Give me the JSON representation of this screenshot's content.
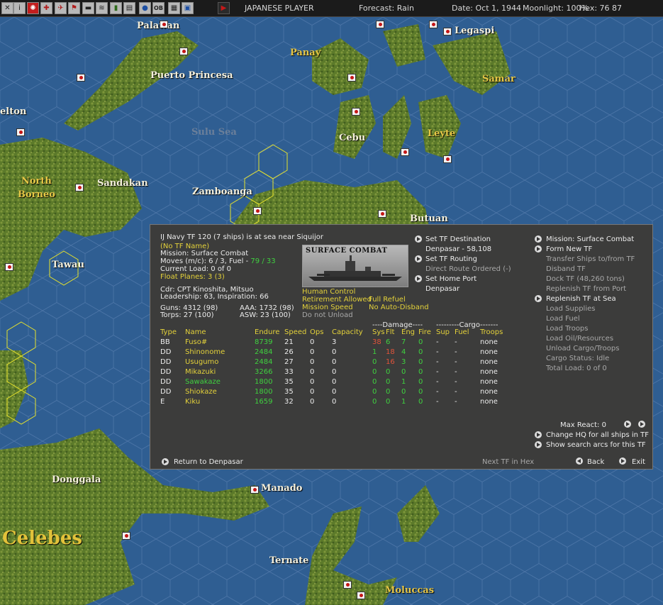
{
  "toolbar": {
    "player": "JAPANESE PLAYER",
    "forecast": "Forecast: Rain",
    "date": "Date: Oct 1, 1944",
    "moonlight": "Moonlight: 100%",
    "hex": "Hex: 76 87",
    "buttons": [
      "close-icon",
      "info-icon",
      "rising-sun-icon",
      "army-icon",
      "navy-icon",
      "flag-icon",
      "transport-icon",
      "intel-icon",
      "fuel-icon",
      "ledger-icon",
      "globe-icon",
      "ob-icon",
      "report-icon",
      "window-icon",
      "play-icon"
    ]
  },
  "map": {
    "places": [
      "Palawan",
      "Legaspi",
      "Panay",
      "Samar",
      "Puerto Princesa",
      "elton",
      "Sulu Sea",
      "Cebu",
      "Leyte",
      "North",
      "Borneo",
      "Sandakan",
      "Zamboanga",
      "Butuan",
      "Tawau",
      "Donggala",
      "Manado",
      "Celebes",
      "Ternate",
      "Moluccas"
    ]
  },
  "panel": {
    "header": "IJ Navy TF 120 (7 ships) is at sea near Siquijor",
    "tf_name": "(No TF Name)",
    "mission": "Mission: Surface Combat",
    "moves_prefix": "Moves (m/c): 6 / 3, Fuel - ",
    "fuel_value": "79 / 33",
    "current_load": "Current Load: 0 of 0",
    "float_planes": "Float Planes: 3 (3)",
    "cdr": "Cdr: CPT  Kinoshita, Mitsuo",
    "leadership": "Leadership: 63, Inspiration: 66",
    "guns": "Guns: 4312 (98)",
    "aaa": "AAA: 1732 (98)",
    "torps": "Torps: 27 (100)",
    "asw": "ASW: 23 (100)",
    "image_title": "SURFACE COMBAT",
    "options": {
      "human_control": "Human Control",
      "retirement": "Retirement Allowed",
      "full_refuel": "Full Refuel",
      "mission_speed": "Mission Speed",
      "no_auto_disband": "No Auto-Disband",
      "do_not_unload": "Do not Unload"
    },
    "routing": {
      "set_destination": "Set TF Destination",
      "destination": "Denpasar - 58,108",
      "set_routing": "Set TF Routing",
      "direct_route": "Direct Route Ordered (-)",
      "set_home_port": "Set Home Port",
      "home_port": "Denpasar"
    },
    "commands": {
      "mission": "Mission: Surface Combat",
      "form_new": "Form New TF",
      "transfer": "Transfer Ships to/from TF",
      "disband": "Disband TF",
      "dock": "Dock TF (48,260 tons)",
      "replenish_port": "Replenish TF from Port",
      "replenish_sea": "Replenish TF at Sea",
      "load_supplies": "Load Supplies",
      "load_fuel": "Load Fuel",
      "load_troops": "Load Troops",
      "load_oil": "Load Oil/Resources",
      "unload": "Unload Cargo/Troops",
      "cargo_status": "Cargo Status: Idle",
      "total_load": "Total Load: 0 of 0"
    },
    "table": {
      "damage_group": "----Damage----",
      "cargo_group": "---------Cargo-------",
      "headers": [
        "Type",
        "Name",
        "Endure",
        "Speed",
        "Ops",
        "Capacity",
        "Sys",
        "Flt",
        "Eng",
        "Fire",
        "Sup",
        "Fuel",
        "Troops"
      ],
      "rows": [
        {
          "type": "BB",
          "name": "Fuso#",
          "endure": "8739",
          "speed": "21",
          "ops": "0",
          "capacity": "3",
          "sys": "38",
          "flt": "6",
          "eng": "7",
          "fire": "0",
          "sup": "-",
          "fuel": "-",
          "troops": "none"
        },
        {
          "type": "DD",
          "name": "Shinonome",
          "endure": "2484",
          "speed": "26",
          "ops": "0",
          "capacity": "0",
          "sys": "1",
          "flt": "18",
          "eng": "4",
          "fire": "0",
          "sup": "-",
          "fuel": "-",
          "troops": "none"
        },
        {
          "type": "DD",
          "name": "Usugumo",
          "endure": "2484",
          "speed": "27",
          "ops": "0",
          "capacity": "0",
          "sys": "0",
          "flt": "16",
          "eng": "3",
          "fire": "0",
          "sup": "-",
          "fuel": "-",
          "troops": "none"
        },
        {
          "type": "DD",
          "name": "Mikazuki",
          "endure": "3266",
          "speed": "33",
          "ops": "0",
          "capacity": "0",
          "sys": "0",
          "flt": "0",
          "eng": "0",
          "fire": "0",
          "sup": "-",
          "fuel": "-",
          "troops": "none"
        },
        {
          "type": "DD",
          "name": "Sawakaze",
          "endure": "1800",
          "speed": "35",
          "ops": "0",
          "capacity": "0",
          "sys": "0",
          "flt": "0",
          "eng": "1",
          "fire": "0",
          "sup": "-",
          "fuel": "-",
          "troops": "none"
        },
        {
          "type": "DD",
          "name": "Shiokaze",
          "endure": "1800",
          "speed": "35",
          "ops": "0",
          "capacity": "0",
          "sys": "0",
          "flt": "0",
          "eng": "0",
          "fire": "0",
          "sup": "-",
          "fuel": "-",
          "troops": "none"
        },
        {
          "type": "E",
          "name": "Kiku",
          "endure": "1659",
          "speed": "32",
          "ops": "0",
          "capacity": "0",
          "sys": "0",
          "flt": "0",
          "eng": "1",
          "fire": "0",
          "sup": "-",
          "fuel": "-",
          "troops": "none"
        }
      ]
    },
    "max_react": "Max React:  0",
    "change_hq": "Change HQ for all ships in TF",
    "show_arcs": "Show search arcs for this TF",
    "return": "Return to Denpasar",
    "next_tf": "Next TF in Hex",
    "back": "Back",
    "exit": "Exit"
  }
}
